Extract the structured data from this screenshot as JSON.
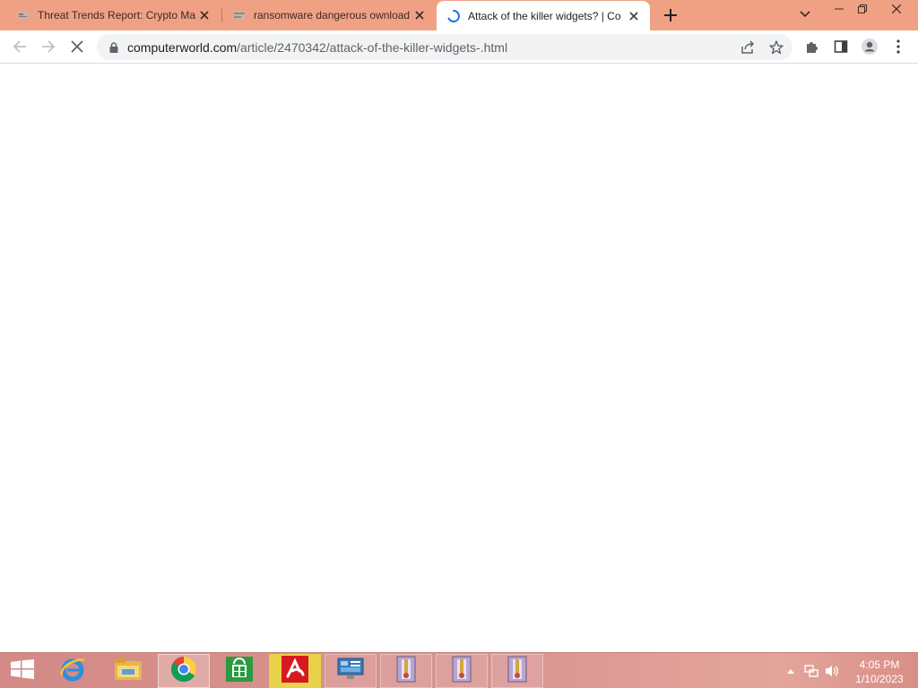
{
  "browser": {
    "tabs": [
      {
        "title": "Threat Trends Report: Crypto Ma",
        "favicon": "report-favicon",
        "active": false
      },
      {
        "title": "ransomware dangerous ownload",
        "favicon": "image-favicon",
        "active": false
      },
      {
        "title": "Attack of the killer widgets? | Co",
        "favicon": "loading-spinner",
        "active": true
      }
    ],
    "new_tab_label": "+",
    "address": {
      "domain": "computerworld.com",
      "path": "/article/2470342/attack-of-the-killer-widgets-.html"
    },
    "icons": {
      "back": "back-arrow-icon",
      "forward": "forward-arrow-icon",
      "stop": "stop-icon",
      "lock": "lock-icon",
      "share": "share-icon",
      "bookmark": "star-icon",
      "extensions": "puzzle-icon",
      "side_panel": "side-panel-icon",
      "profile": "profile-icon",
      "menu": "kebab-menu-icon"
    },
    "accent_color": "#f0a184"
  },
  "taskbar": {
    "items": [
      {
        "name": "start-button",
        "icon": "windows-logo-icon"
      },
      {
        "name": "internet-explorer",
        "icon": "ie-icon"
      },
      {
        "name": "file-explorer",
        "icon": "folder-icon"
      },
      {
        "name": "google-chrome",
        "icon": "chrome-icon"
      },
      {
        "name": "windows-store",
        "icon": "store-icon"
      },
      {
        "name": "avira",
        "icon": "avira-icon"
      },
      {
        "name": "control-panel",
        "icon": "control-panel-icon"
      },
      {
        "name": "archive-1",
        "icon": "archive-icon"
      },
      {
        "name": "archive-2",
        "icon": "archive-icon"
      },
      {
        "name": "archive-3",
        "icon": "archive-icon"
      }
    ],
    "clock": {
      "time": "4:05 PM",
      "date": "1/10/2023"
    }
  }
}
